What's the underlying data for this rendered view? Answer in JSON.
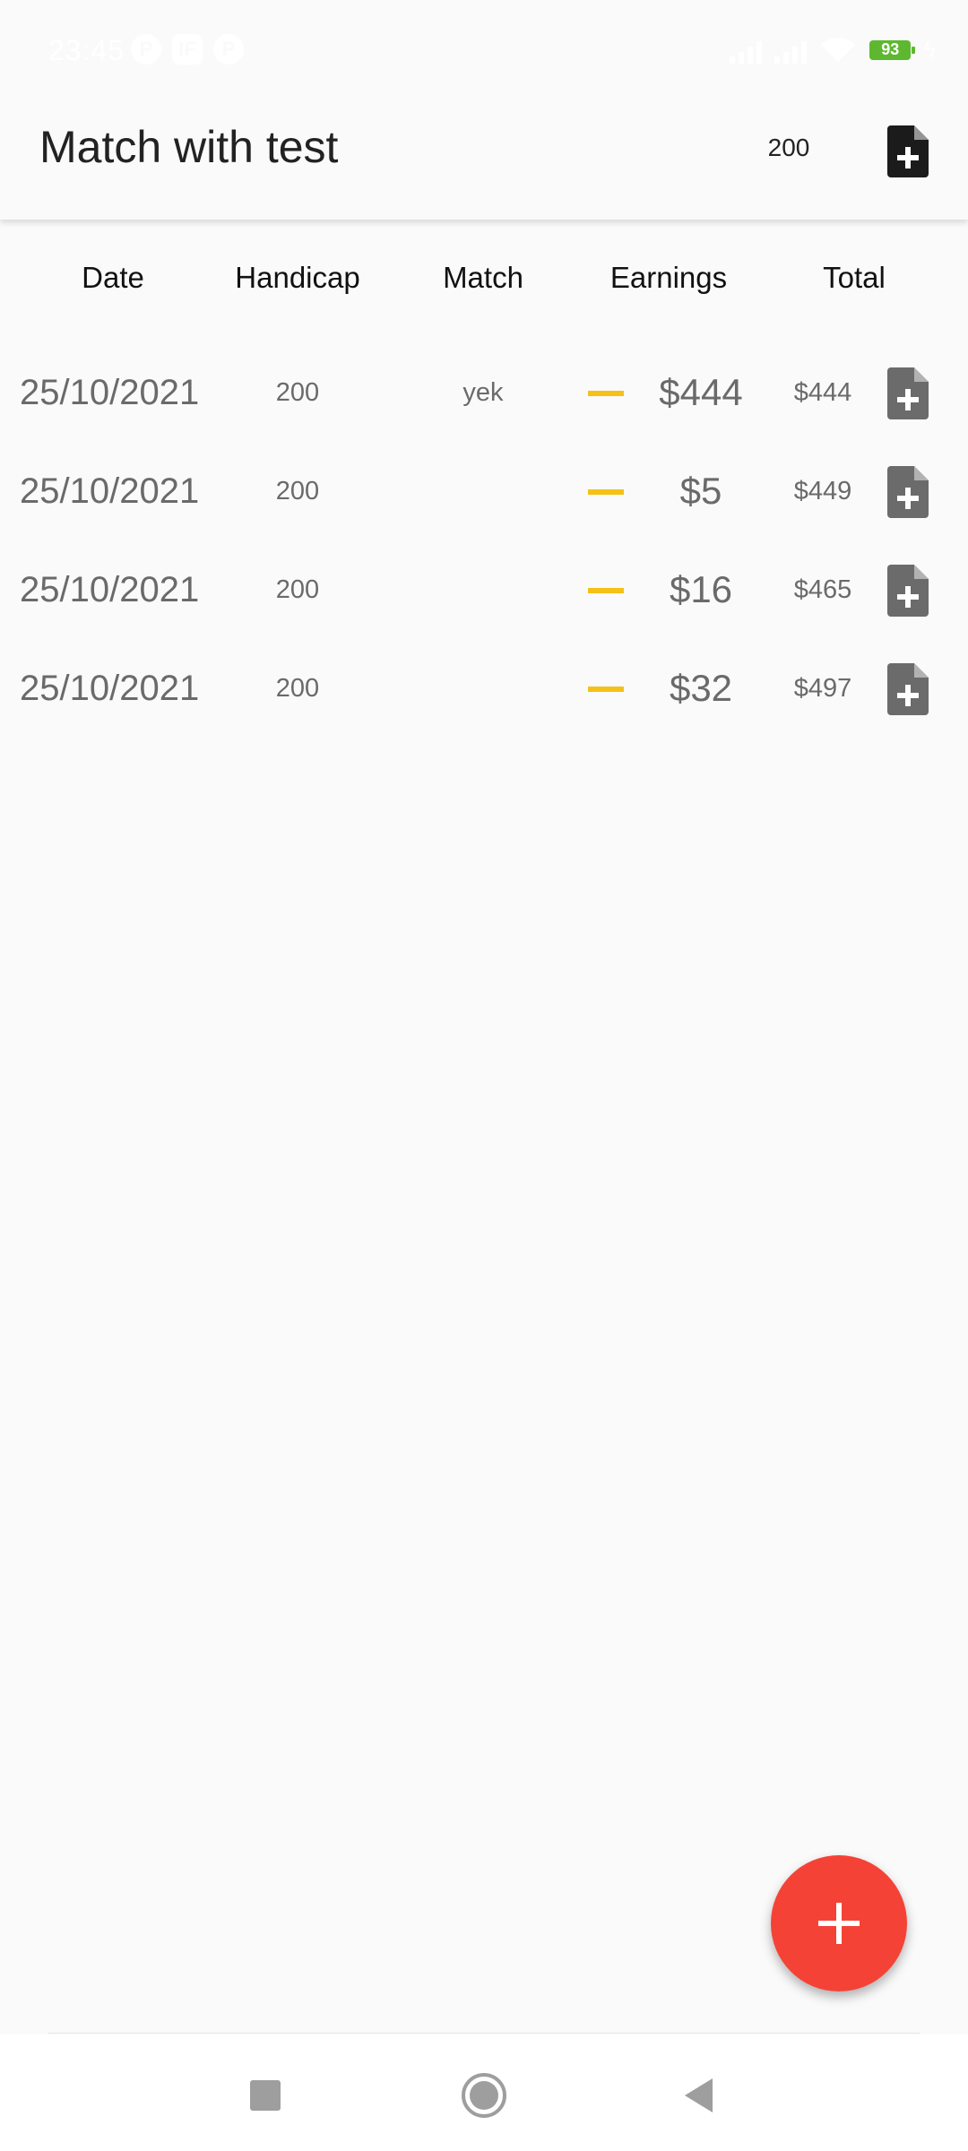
{
  "status_bar": {
    "time": "23:45",
    "app_icons": [
      "P",
      "IF",
      "P"
    ],
    "battery": "93"
  },
  "app_bar": {
    "title": "Match with test",
    "value": "200"
  },
  "table": {
    "headers": {
      "date": "Date",
      "handicap": "Handicap",
      "match": "Match",
      "earnings": "Earnings",
      "total": "Total"
    },
    "rows": [
      {
        "date": "25/10/2021",
        "handicap": "200",
        "match": "yek",
        "earnings": "$444",
        "total": "$444"
      },
      {
        "date": "25/10/2021",
        "handicap": "200",
        "match": "",
        "earnings": "$5",
        "total": "$449"
      },
      {
        "date": "25/10/2021",
        "handicap": "200",
        "match": "",
        "earnings": "$16",
        "total": "$465"
      },
      {
        "date": "25/10/2021",
        "handicap": "200",
        "match": "",
        "earnings": "$32",
        "total": "$497"
      }
    ]
  },
  "colors": {
    "accent_fab": "#f44336",
    "dash": "#f5c116",
    "battery": "#5db82f"
  },
  "icons": {
    "app_bar_action": "note-add-icon",
    "row_action": "note-add-icon",
    "fab": "plus-icon",
    "nav": [
      "recents-square-icon",
      "home-circle-icon",
      "back-triangle-icon"
    ]
  }
}
